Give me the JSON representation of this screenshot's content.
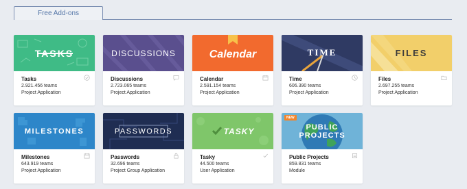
{
  "tab": {
    "label": "Free Add-ons"
  },
  "addons": [
    {
      "key": "tasks",
      "banner_text": "TASKS",
      "name": "Tasks",
      "teams": "2.921.456 teams",
      "type": "Project Application",
      "icon": "check-icon",
      "bg": "#3fbb86"
    },
    {
      "key": "discussions",
      "banner_text": "DISCUSSIONS",
      "name": "Discussions",
      "teams": "2.723.065 teams",
      "type": "Project Application",
      "icon": "comment-icon",
      "bg": "#5a4f8e"
    },
    {
      "key": "calendar",
      "banner_text": "Calendar",
      "name": "Calendar",
      "teams": "2.591.154 teams",
      "type": "Project Application",
      "icon": "calendar-icon",
      "bg": "#f26a2e"
    },
    {
      "key": "time",
      "banner_text": "TIME",
      "name": "Time",
      "teams": "606.390 teams",
      "type": "Project Application",
      "icon": "clock-icon",
      "bg": "#2f3a63"
    },
    {
      "key": "files",
      "banner_text": "FILES",
      "name": "Files",
      "teams": "2.697.255 teams",
      "type": "Project Application",
      "icon": "folder-icon",
      "bg": "#f2cf6a"
    },
    {
      "key": "milestones",
      "banner_text": "MILESTONES",
      "name": "Milestones",
      "teams": "643.919 teams",
      "type": "Project Application",
      "icon": "calendar-icon",
      "bg": "#2d86c9"
    },
    {
      "key": "passwords",
      "banner_text": "PASSWORDS",
      "name": "Passwords",
      "teams": "32.696 teams",
      "type": "Project Group Application",
      "icon": "lock-icon",
      "bg": "#1f2d52"
    },
    {
      "key": "tasky",
      "banner_text": "TASKY",
      "name": "Tasky",
      "teams": "44.500 teams",
      "type": "User Application",
      "icon": "check-icon",
      "bg": "#7fc66a"
    },
    {
      "key": "public-projects",
      "banner_text": "PUBLIC PROJECTS",
      "badge": "NEW",
      "name": "Public Projects",
      "teams": "859.831 teams",
      "type": "Module",
      "icon": "document-icon",
      "bg": "#6fb3d8"
    }
  ]
}
